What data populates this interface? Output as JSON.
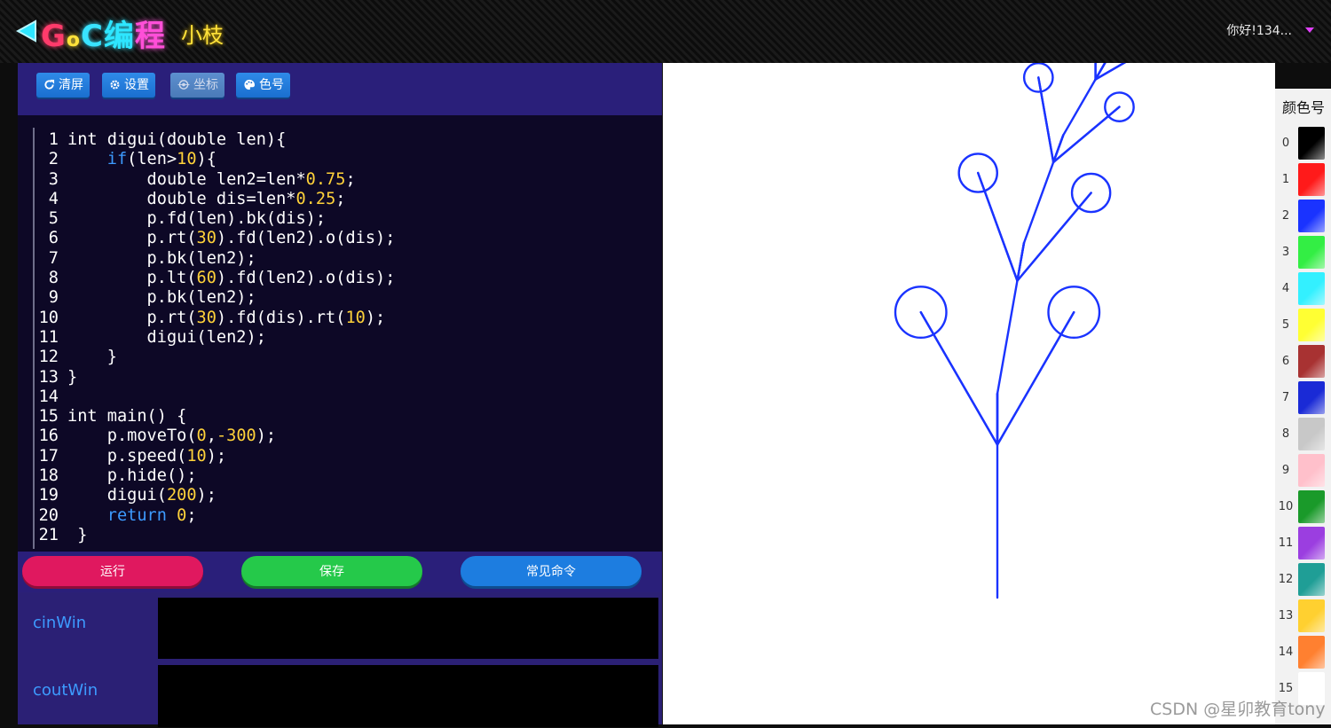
{
  "header": {
    "logo_text": "GoC编程",
    "subtitle": "小枝",
    "user_greeting": "你好!134..."
  },
  "toolbar": {
    "clear_label": "清屏",
    "settings_label": "设置",
    "coords_label": "坐标",
    "colors_label": "色号"
  },
  "editor": {
    "lines": [
      {
        "n": "1",
        "code": "int digui(double len){"
      },
      {
        "n": "2",
        "code": "    if(len>10){"
      },
      {
        "n": "3",
        "code": "        double len2=len*0.75;"
      },
      {
        "n": "4",
        "code": "        double dis=len*0.25;"
      },
      {
        "n": "5",
        "code": "        p.fd(len).bk(dis);"
      },
      {
        "n": "6",
        "code": "        p.rt(30).fd(len2).o(dis);"
      },
      {
        "n": "7",
        "code": "        p.bk(len2);"
      },
      {
        "n": "8",
        "code": "        p.lt(60).fd(len2).o(dis);"
      },
      {
        "n": "9",
        "code": "        p.bk(len2);"
      },
      {
        "n": "10",
        "code": "        p.rt(30).fd(dis).rt(10);"
      },
      {
        "n": "11",
        "code": "        digui(len2);"
      },
      {
        "n": "12",
        "code": "    }"
      },
      {
        "n": "13",
        "code": "}"
      },
      {
        "n": "14",
        "code": ""
      },
      {
        "n": "15",
        "code": "int main() {"
      },
      {
        "n": "16",
        "code": "    p.moveTo(0,-300);"
      },
      {
        "n": "17",
        "code": "    p.speed(10);"
      },
      {
        "n": "18",
        "code": "    p.hide();"
      },
      {
        "n": "19",
        "code": "    digui(200);"
      },
      {
        "n": "20",
        "code": "    return 0;"
      },
      {
        "n": "21",
        "code": " }"
      }
    ]
  },
  "actions": {
    "run_label": "运行",
    "save_label": "保存",
    "commands_label": "常见命令"
  },
  "io": {
    "cin_label": "cinWin",
    "cout_label": "coutWin"
  },
  "palette": {
    "title": "颜色号",
    "swatches": [
      {
        "num": "0",
        "color": "#000000"
      },
      {
        "num": "1",
        "color": "#ff1a1a"
      },
      {
        "num": "2",
        "color": "#1a33ff"
      },
      {
        "num": "3",
        "color": "#33ee44"
      },
      {
        "num": "4",
        "color": "#33f0ff"
      },
      {
        "num": "5",
        "color": "#ffff33"
      },
      {
        "num": "6",
        "color": "#a83232"
      },
      {
        "num": "7",
        "color": "#1a2ad6"
      },
      {
        "num": "8",
        "color": "#c8c8c8"
      },
      {
        "num": "9",
        "color": "#ffc0cb"
      },
      {
        "num": "10",
        "color": "#1a9a2a"
      },
      {
        "num": "11",
        "color": "#9b3ee0"
      },
      {
        "num": "12",
        "color": "#1f9e96"
      },
      {
        "num": "13",
        "color": "#ffd030"
      },
      {
        "num": "14",
        "color": "#ff8030"
      },
      {
        "num": "15",
        "color": "#ffffff"
      }
    ]
  },
  "drawing": {
    "stroke_color": "#1a33ff"
  },
  "watermark": "CSDN @星卯教育tony"
}
